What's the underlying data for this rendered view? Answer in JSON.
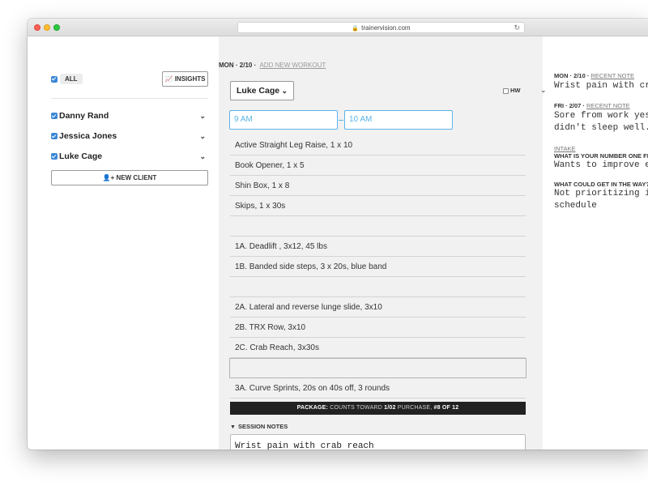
{
  "browser": {
    "url": "trainervision.com"
  },
  "sidebar": {
    "all_label": "ALL",
    "insights_label": "INSIGHTS",
    "clients": [
      {
        "name": "Danny Rand"
      },
      {
        "name": "Jessica Jones"
      },
      {
        "name": "Luke Cage"
      }
    ],
    "new_client_label": "NEW CLIENT"
  },
  "workout": {
    "date": "MON · 2/10 ·",
    "add_new": "ADD NEW WORKOUT",
    "client_selected": "Luke Cage",
    "hw_label": "HW",
    "start_time": "9 AM",
    "end_time": "10 AM",
    "exercises": [
      "Active Straight Leg Raise, 1 x 10",
      "Book Opener, 1 x 5",
      "Shin Box, 1 x 8",
      "Skips, 1 x 30s",
      "",
      "1A. Deadlift , 3x12, 45 lbs",
      "1B. Banded side steps, 3 x 20s, blue band",
      "",
      "2A. Lateral and reverse lunge slide, 3x10",
      "2B. TRX Row, 3x10",
      "2C. Crab Reach, 3x30s",
      "",
      "3A. Curve Sprints, 20s on 40s off, 3 rounds"
    ],
    "package": {
      "label": "PACKAGE:",
      "counts_text": "COUNTS TOWARD",
      "purchase_date": "1/02",
      "purchase_text": "PURCHASE,",
      "session_number": "#8 OF 12"
    },
    "session_notes_label": "SESSION NOTES",
    "session_notes_text": "Wrist pain with crab reach"
  },
  "right_panel": {
    "note1_date": "MON · 2/10 ·",
    "note1_label": "RECENT NOTE",
    "note1_text": "Wrist pain with cra",
    "note2_date": "FRI · 2/07 ·",
    "note2_label": "RECENT NOTE",
    "note2_line1": "Sore from work yest",
    "note2_line2": "didn't sleep well.",
    "intake_label": "INTAKE",
    "q1": "WHAT IS YOUR NUMBER ONE FI",
    "a1": "Wants to improve en",
    "q2": "WHAT COULD GET IN THE WAY?",
    "a2_line1": "Not prioritizing it",
    "a2_line2": "schedule"
  }
}
